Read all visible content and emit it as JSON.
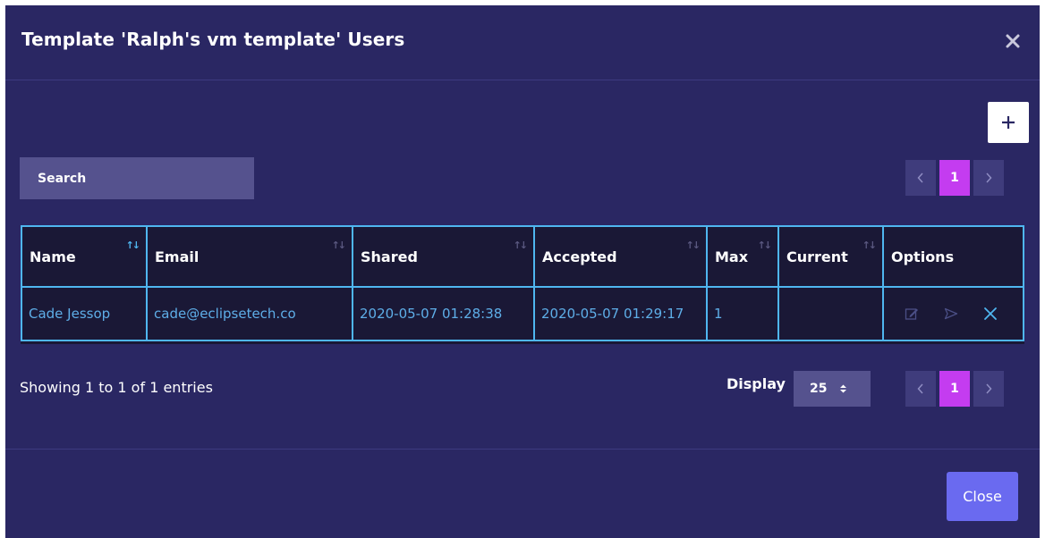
{
  "modal": {
    "title": "Template 'Ralph's vm template' Users",
    "close_icon": "close-x-icon"
  },
  "toolbar": {
    "add_label": "+",
    "search_placeholder": "Search"
  },
  "pagination": {
    "prev_label": "<",
    "current_page": "1",
    "next_label": ">"
  },
  "table": {
    "columns": [
      "Name",
      "Email",
      "Shared",
      "Accepted",
      "Max",
      "Current",
      "Options"
    ],
    "rows": [
      {
        "name": "Cade Jessop",
        "email": "cade@eclipsetech.co",
        "shared": "2020-05-07 01:28:38",
        "accepted": "2020-05-07 01:29:17",
        "max": "1",
        "current": "",
        "options": [
          "edit-icon",
          "send-icon",
          "delete-x-icon"
        ]
      }
    ]
  },
  "footer_info": {
    "entries_text": "Showing 1 to 1 of 1 entries",
    "display_label": "Display",
    "display_value": "25"
  },
  "actions": {
    "close_label": "Close"
  },
  "colors": {
    "modal_bg": "#2a2763",
    "table_bg": "#1a1836",
    "table_border": "#4fb6f0",
    "link_text": "#5eaee8",
    "page_active": "#c43cf0",
    "close_button": "#6a6af0"
  }
}
